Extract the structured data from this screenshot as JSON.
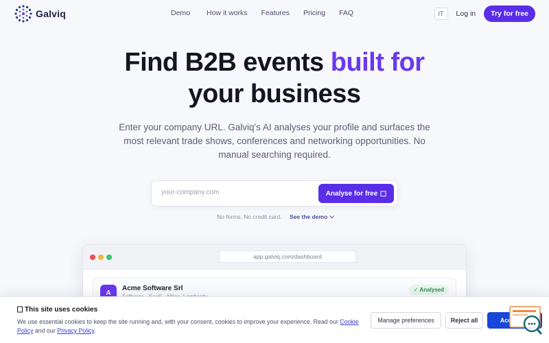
{
  "brand": {
    "name": "Galviq"
  },
  "nav": {
    "links": [
      "Demo",
      "How it works",
      "Features",
      "Pricing",
      "FAQ"
    ],
    "lang": "IT",
    "login": "Log in",
    "cta": "Try for free"
  },
  "hero": {
    "title_part1": "Find B2B events",
    "title_accent": "built for",
    "title_part2": "your business",
    "subtitle": "Enter your company URL. Galviq's AI analyses your profile and surfaces the most relevant trade shows, conferences and networking opportunities. No manual searching required.",
    "input_placeholder": "your-company.com",
    "analyse_label": "Analyse for free",
    "analyse_icon": "arrow-icon",
    "note": "No forms. No credit card.",
    "demo_link": "See the demo"
  },
  "preview": {
    "url": "app.galviq.com/dashboard",
    "avatar_letter": "A",
    "company": "Acme Software Srl",
    "company_sub": "Software · SaaS · Milan, Lombardy",
    "status": "✓ Analysed"
  },
  "cookie": {
    "title": "This site uses cookies",
    "text_before": "We use essential cookies to keep the site running and, with your consent, cookies to improve your experience. Read our ",
    "cookie_policy": "Cookie Policy",
    "text_mid": " and our ",
    "privacy_policy": "Privacy Policy",
    "text_end": ".",
    "manage": "Manage preferences",
    "reject": "Reject all",
    "accept": "Accept all"
  },
  "colors": {
    "accent": "#6a38ef",
    "cta": "#5a2ee8",
    "accept": "#1747d6"
  }
}
